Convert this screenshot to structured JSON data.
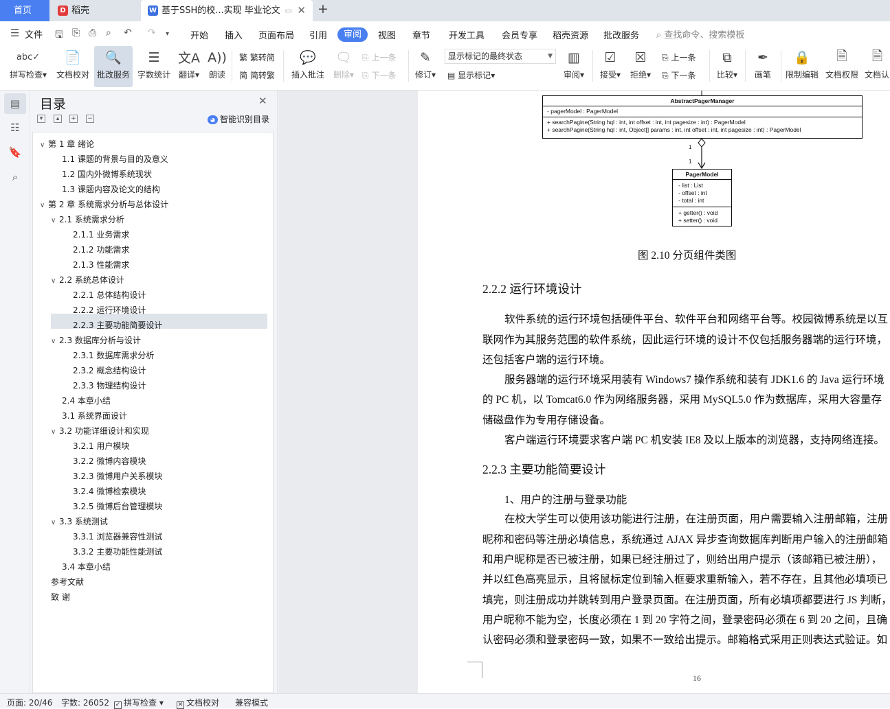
{
  "tabs": {
    "home": "首页",
    "daoke": "稻壳",
    "doc": "基于SSH的校...实现 毕业论文"
  },
  "menu": {
    "file": "文件",
    "items": [
      "开始",
      "插入",
      "页面布局",
      "引用",
      "审阅",
      "视图",
      "章节",
      "开发工具",
      "会员专享",
      "稻壳资源",
      "批改服务"
    ],
    "active": "审阅",
    "search": "查找命令、搜索模板"
  },
  "ribbon": {
    "spell": "拼写检查",
    "proof": "文档校对",
    "grade": "批改服务",
    "wordcount": "字数统计",
    "translate": "翻译",
    "read": "朗读",
    "t2s": "繁转简",
    "s2t": "简转繁",
    "insert_comment": "插入批注",
    "delete": "删除",
    "prev": "上一条",
    "next": "下一条",
    "track": "修订",
    "markup_state": "显示标记的最终状态",
    "show_markup": "显示标记",
    "review": "审阅",
    "accept": "接受",
    "reject": "拒绝",
    "prev2": "上一条",
    "next2": "下一条",
    "compare": "比较",
    "pen": "画笔",
    "restrict": "限制编辑",
    "perm": "文档权限",
    "auth": "文档认"
  },
  "toc": {
    "title": "目录",
    "smart": "智能识别目录",
    "items": [
      {
        "text": "第 1 章  绪论",
        "level": 0,
        "caret": "∨"
      },
      {
        "text": "1.1  课题的背景与目的及意义",
        "level": 1
      },
      {
        "text": "1.2  国内外微博系统现状",
        "level": 1
      },
      {
        "text": "1.3  课题内容及论文的结构",
        "level": 1
      },
      {
        "text": "第 2 章  系统需求分析与总体设计",
        "level": 0,
        "caret": "∨"
      },
      {
        "text": "2.1  系统需求分析",
        "level": 1,
        "caret": "∨"
      },
      {
        "text": "2.1.1  业务需求",
        "level": 2
      },
      {
        "text": "2.1.2  功能需求",
        "level": 2
      },
      {
        "text": "2.1.3  性能需求",
        "level": 2
      },
      {
        "text": "2.2  系统总体设计",
        "level": 1,
        "caret": "∨"
      },
      {
        "text": "2.2.1  总体结构设计",
        "level": 2
      },
      {
        "text": "2.2.2  运行环境设计",
        "level": 2
      },
      {
        "text": "2.2.3  主要功能简要设计",
        "level": 2
      },
      {
        "text": "2.3  数据库分析与设计",
        "level": 1,
        "caret": "∨"
      },
      {
        "text": "2.3.1  数据库需求分析",
        "level": 2
      },
      {
        "text": "2.3.2  概念结构设计",
        "level": 2
      },
      {
        "text": "2.3.3  物理结构设计",
        "level": 2
      },
      {
        "text": "2.4  本章小结",
        "level": 1
      },
      {
        "text": "3.1  系统界面设计",
        "level": 1
      },
      {
        "text": "3.2  功能详细设计和实现",
        "level": 1,
        "caret": "∨"
      },
      {
        "text": "3.2.1  用户模块",
        "level": 2
      },
      {
        "text": "3.2.2  微博内容模块",
        "level": 2
      },
      {
        "text": "3.2.3  微博用户关系模块",
        "level": 2
      },
      {
        "text": "3.2.4  微博检索模块",
        "level": 2
      },
      {
        "text": "3.2.5  微博后台管理模块",
        "level": 2
      },
      {
        "text": "3.3  系统测试",
        "level": 1,
        "caret": "∨"
      },
      {
        "text": "3.3.1  浏览器兼容性测试",
        "level": 2
      },
      {
        "text": "3.3.2  主要功能性能测试",
        "level": 2
      },
      {
        "text": "3.4  本章小结",
        "level": 1
      },
      {
        "text": "参考文献",
        "level": 0
      },
      {
        "text": "致      谢",
        "level": 0
      }
    ]
  },
  "doc": {
    "uml": {
      "manager_title": "AbstractPagerManager",
      "manager_attr": "- pagerModel : PagerModel",
      "manager_op1": "+ searchPagine(String hql : int, int offset : int, int pagesize : int) : PagerModel",
      "manager_op2": "+ searchPagine(String hql : int, Object[] params : int, int offset : int, int pagesize : int) : PagerModel",
      "mult_top": "1",
      "mult_bottom": "1",
      "model_title": "PagerModel",
      "model_attrs": [
        "- list : List",
        "- offset : int",
        "- total : int"
      ],
      "model_ops": [
        "+ getter() : void",
        "+ setter() : void"
      ]
    },
    "caption": "图 2.10  分页组件类图",
    "h_222": "2.2.2  运行环境设计",
    "p1": [
      "软件系统的运行环境包括硬件平台、软件平台和网络平台等。校园微博系统是以互",
      "联网作为其服务范围的软件系统，因此运行环境的设计不仅包括服务器端的运行环境，",
      "还包括客户端的运行环境。"
    ],
    "p2": [
      "服务器端的运行环境采用装有 Windows7 操作系统和装有 JDK1.6 的 Java 运行环境",
      "的 PC 机，以 Tomcat6.0 作为网络服务器，采用 MySQL5.0 作为数据库，采用大容量存",
      "储磁盘作为专用存储设备。"
    ],
    "p3": "客户端运行环境要求客户端 PC 机安装 IE8 及以上版本的浏览器，支持网络连接。",
    "h_223": "2.2.3  主要功能简要设计",
    "sub1": "1、用户的注册与登录功能",
    "p4": [
      "在校大学生可以使用该功能进行注册，在注册页面，用户需要输入注册邮箱，注册",
      "昵称和密码等注册必填信息，系统通过 AJAX 异步查询数据库判断用户输入的注册邮箱",
      "和用户昵称是否已被注册，如果已经注册过了，则给出用户提示（该邮箱已被注册），",
      "并以红色高亮显示，且将鼠标定位到输入框要求重新输入，若不存在，且其他必填项已",
      "填完，则注册成功并跳转到用户登录页面。在注册页面，所有必填项都要进行 JS 判断，",
      "用户昵称不能为空，长度必须在 1 到 20 字符之间，登录密码必须在 6 到 20 之间，且确",
      "认密码必须和登录密码一致，如果不一致给出提示。邮箱格式采用正则表达式验证。如"
    ],
    "page_number": "16"
  },
  "status": {
    "page": "页面: 20/46",
    "words": "字数: 26052",
    "spell": "拼写检查",
    "proof": "文档校对",
    "compat": "兼容模式"
  },
  "colors": {
    "accent": "#4a7ff1"
  }
}
